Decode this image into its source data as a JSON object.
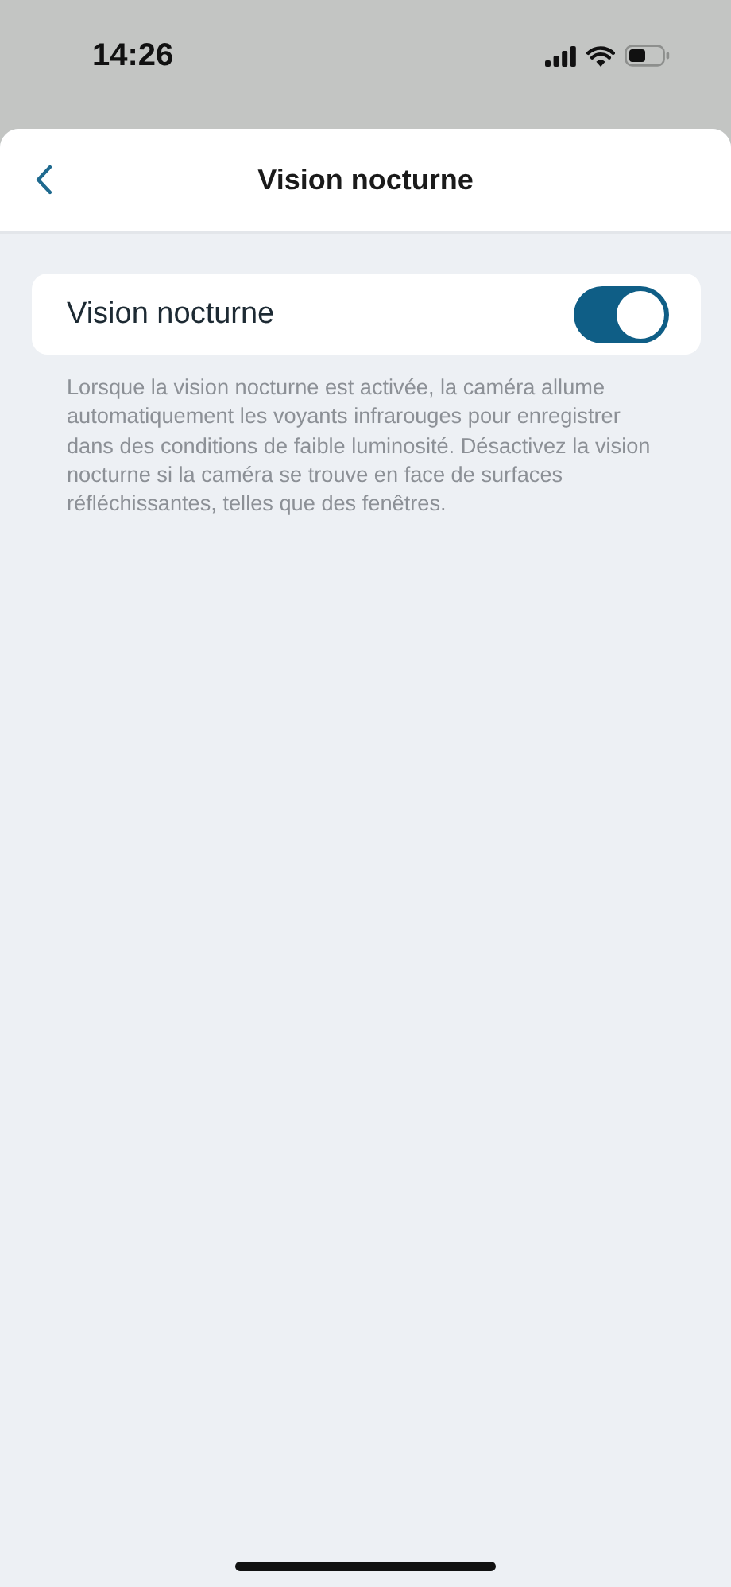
{
  "status_bar": {
    "time": "14:26"
  },
  "header": {
    "title": "Vision nocturne"
  },
  "setting": {
    "label": "Vision nocturne",
    "on": true
  },
  "description": "Lorsque la vision nocturne est activée, la caméra allume automatiquement les voyants infrarouges pour enregistrer dans des conditions de faible luminosité. Désactivez la vision nocturne si la caméra se trouve en face de surfaces réfléchissantes, telles que des fenêtres."
}
